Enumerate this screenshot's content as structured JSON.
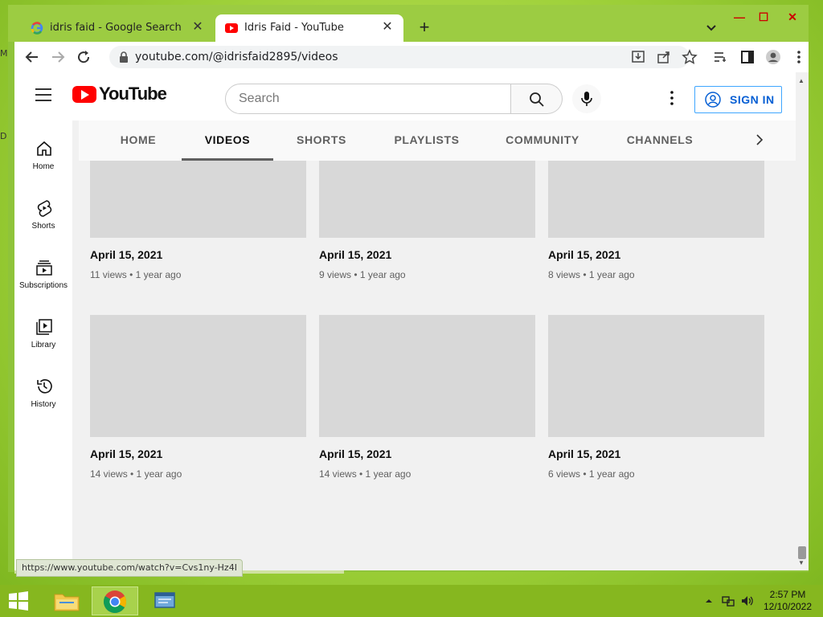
{
  "desktop": {
    "left_marks": [
      "M",
      "D"
    ]
  },
  "browser": {
    "tabs": [
      {
        "title": "idris faid - Google Search",
        "favicon": "google-icon",
        "active": false
      },
      {
        "title": "Idris Faid - YouTube",
        "favicon": "youtube-icon",
        "active": true
      }
    ],
    "new_tab": "+",
    "close_glyph": "✕",
    "window_controls": {
      "minimize": "—",
      "maximize": "☐",
      "close": "✕"
    },
    "address": "youtube.com/@idrisfaid2895/videos",
    "status_url": "https://www.youtube.com/watch?v=Cvs1ny-Hz4I"
  },
  "youtube": {
    "logo_text": "YouTube",
    "search_placeholder": "Search",
    "sign_in": "SIGN IN",
    "sidebar": [
      {
        "label": "Home",
        "icon": "home-icon"
      },
      {
        "label": "Shorts",
        "icon": "shorts-icon"
      },
      {
        "label": "Subscriptions",
        "icon": "subscriptions-icon"
      },
      {
        "label": "Library",
        "icon": "library-icon"
      },
      {
        "label": "History",
        "icon": "history-icon"
      }
    ],
    "channel_tabs": [
      "HOME",
      "VIDEOS",
      "SHORTS",
      "PLAYLISTS",
      "COMMUNITY",
      "CHANNELS"
    ],
    "selected_tab": "VIDEOS",
    "videos": [
      {
        "title": "April 15, 2021",
        "meta": "11 views • 1 year ago"
      },
      {
        "title": "April 15, 2021",
        "meta": "9 views • 1 year ago"
      },
      {
        "title": "April 15, 2021",
        "meta": "8 views • 1 year ago"
      },
      {
        "title": "April 15, 2021",
        "meta": "14 views • 1 year ago"
      },
      {
        "title": "April 15, 2021",
        "meta": "14 views • 1 year ago"
      },
      {
        "title": "April 15, 2021",
        "meta": "6 views • 1 year ago"
      }
    ]
  },
  "taskbar": {
    "time": "2:57 PM",
    "date": "12/10/2022"
  },
  "colors": {
    "youtube_red": "#ff0000",
    "sign_in_blue": "#065fd4",
    "desktop_green": "#9fd13a"
  }
}
